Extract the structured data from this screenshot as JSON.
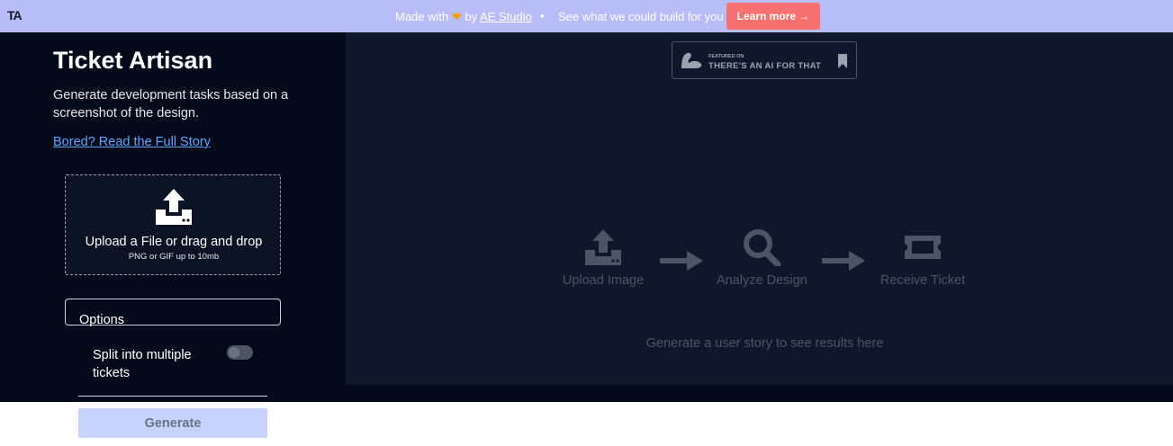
{
  "banner": {
    "logo": "TA",
    "made_with": "Made with",
    "by": "by",
    "studio_link": "AE Studio",
    "separator": "•",
    "see_text": "See what we could build for you",
    "learn_more": "Learn more →"
  },
  "sidebar": {
    "title": "Ticket Artisan",
    "description": "Generate development tasks based on a screenshot of the design.",
    "story_link": "Bored? Read the Full Story",
    "upload": {
      "title": "Upload a File or drag and drop",
      "subtitle": "PNG or GIF up to 10mb"
    },
    "options": {
      "label": "Options",
      "split_label": "Split into multiple tickets",
      "split_enabled": false
    }
  },
  "main": {
    "badge": {
      "small": "FEATURED ON",
      "big": "THERE'S AN AI FOR THAT"
    },
    "steps": [
      {
        "label": "Upload Image",
        "icon": "upload-icon"
      },
      {
        "label": "Analyze Design",
        "icon": "magnifier-icon"
      },
      {
        "label": "Receive Ticket",
        "icon": "ticket-icon"
      }
    ],
    "results_text": "Generate a user story to see results here"
  },
  "generate_button": "Generate",
  "colors": {
    "banner": "#b9bdf7",
    "sidebar": "#050a1a",
    "main": "#0f172a",
    "learn_more": "#f87171",
    "link": "#60a5fa",
    "generate": "#c7d2fe"
  }
}
